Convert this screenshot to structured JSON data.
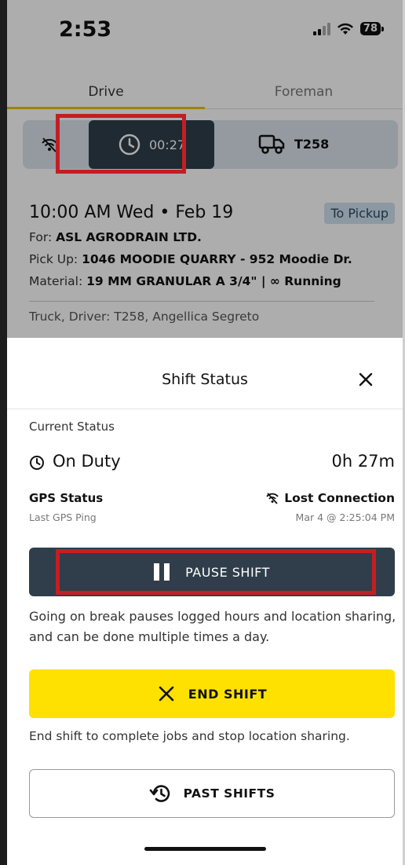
{
  "status_bar": {
    "time": "2:53",
    "battery": "78",
    "icons": [
      "signal-icon",
      "wifi-icon",
      "battery-icon"
    ]
  },
  "tabs": [
    {
      "label": "Drive",
      "active": true
    },
    {
      "label": "Foreman",
      "active": false
    }
  ],
  "vehicle_bar": {
    "gps_icon": "gps-off-icon",
    "timer": "00:27",
    "timer_icon": "clock-icon",
    "truck_icon": "truck-icon",
    "truck": "T258"
  },
  "job": {
    "datetime": "10:00 AM Wed • Feb 19",
    "status_badge": "To Pickup",
    "for_label": "For:",
    "for_value": "ASL AGRODRAIN LTD.",
    "pickup_label": "Pick Up:",
    "pickup_value": "1046 MOODIE QUARRY - 952 Moodie Dr.",
    "material_label": "Material:",
    "material_value": "19 MM GRANULAR A 3/4\" | ∞ Running",
    "truck_driver": "Truck, Driver: T258, Angellica Segreto"
  },
  "sheet": {
    "title": "Shift Status",
    "close_icon": "close-icon",
    "current_status_label": "Current Status",
    "status": "On Duty",
    "duration": "0h 27m",
    "gps_status_label": "GPS Status",
    "gps_status_value": "Lost Connection",
    "last_ping_label": "Last GPS Ping",
    "last_ping_value": "Mar 4 @ 2:25:04 PM",
    "pause_button": "PAUSE SHIFT",
    "pause_description": "Going on break pauses logged hours and location sharing, and can be done multiple times a day.",
    "end_button": "END SHIFT",
    "end_description": "End shift to complete jobs and stop location sharing.",
    "past_button": "PAST SHIFTS"
  },
  "colors": {
    "primary_dark": "#2f3e4a",
    "accent_yellow": "#ffe100",
    "highlight_red": "#c41e22",
    "tab_underline": "#e6c200"
  }
}
